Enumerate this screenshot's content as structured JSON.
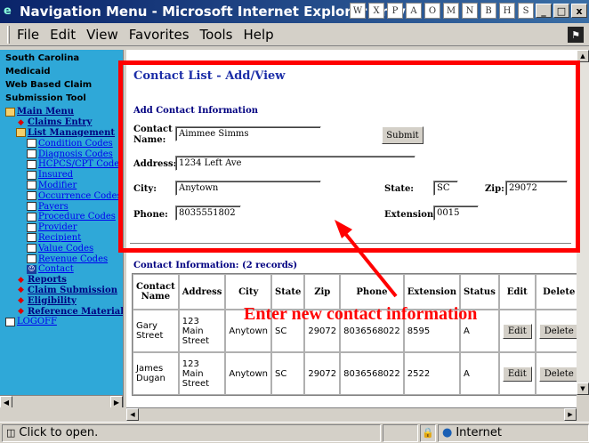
{
  "window": {
    "title": "Navigation Menu - Microsoft Internet Explorer prov",
    "minimize": "_",
    "maximize": "□",
    "close": "x"
  },
  "menu": [
    "File",
    "Edit",
    "View",
    "Favorites",
    "Tools",
    "Help"
  ],
  "sidebar": {
    "header": [
      "South Carolina Medicaid",
      "Web Based Claim",
      "Submission Tool"
    ],
    "items": [
      {
        "label": "Main Menu",
        "icon": "book-icon",
        "level": 0,
        "style": "bold"
      },
      {
        "label": "Claims Entry",
        "icon": "diamond-icon",
        "level": 1,
        "style": "bold"
      },
      {
        "label": "List Management",
        "icon": "book-icon",
        "level": 1,
        "style": "bold"
      },
      {
        "label": "Condition Codes",
        "icon": "page-icon",
        "level": 2,
        "style": "link"
      },
      {
        "label": "Diagnosis Codes",
        "icon": "page-icon",
        "level": 2,
        "style": "link"
      },
      {
        "label": "HCPCS/CPT Codes",
        "icon": "page-icon",
        "level": 2,
        "style": "link"
      },
      {
        "label": "Insured",
        "icon": "page-icon",
        "level": 2,
        "style": "link"
      },
      {
        "label": "Modifier",
        "icon": "page-icon",
        "level": 2,
        "style": "link"
      },
      {
        "label": "Occurrence Codes",
        "icon": "page-icon",
        "level": 2,
        "style": "link"
      },
      {
        "label": "Payers",
        "icon": "page-icon",
        "level": 2,
        "style": "link"
      },
      {
        "label": "Procedure Codes",
        "icon": "page-icon",
        "level": 2,
        "style": "link"
      },
      {
        "label": "Provider",
        "icon": "page-icon",
        "level": 2,
        "style": "link"
      },
      {
        "label": "Recipient",
        "icon": "page-icon",
        "level": 2,
        "style": "link"
      },
      {
        "label": "Value Codes",
        "icon": "page-icon",
        "level": 2,
        "style": "link"
      },
      {
        "label": "Revenue Codes",
        "icon": "page-icon",
        "level": 2,
        "style": "link"
      },
      {
        "label": "Contact",
        "icon": "contact-icon",
        "level": 2,
        "style": "link"
      },
      {
        "label": "Reports",
        "icon": "diamond-icon",
        "level": 1,
        "style": "bold"
      },
      {
        "label": "Claim Submission",
        "icon": "diamond-icon",
        "level": 1,
        "style": "bold"
      },
      {
        "label": "Eligibility",
        "icon": "diamond-icon",
        "level": 1,
        "style": "bold"
      },
      {
        "label": "Reference Materials",
        "icon": "diamond-icon",
        "level": 1,
        "style": "bold"
      },
      {
        "label": "LOGOFF",
        "icon": "page-icon",
        "level": 0,
        "style": "link"
      }
    ]
  },
  "main": {
    "page_title": "Contact List - Add/View",
    "section_title": "Add Contact Information",
    "form": {
      "contact_name_label": "Contact Name:",
      "contact_name_value": "Aimmee Simms",
      "submit_label": "Submit",
      "address_label": "Address:",
      "address_value": "1234 Left Ave",
      "city_label": "City:",
      "city_value": "Anytown",
      "state_label": "State:",
      "state_value": "SC",
      "zip_label": "Zip:",
      "zip_value": "29072",
      "phone_label": "Phone:",
      "phone_value": "8035551802",
      "extension_label": "Extension:",
      "extension_value": "0015"
    },
    "table_title": "Contact Information: (2 records)",
    "table": {
      "headers": [
        "Contact Name",
        "Address",
        "City",
        "State",
        "Zip",
        "Phone",
        "Extension",
        "Status",
        "Edit",
        "Delete"
      ],
      "rows": [
        {
          "name": "Gary Street",
          "address": "123 Main Street",
          "city": "Anytown",
          "state": "SC",
          "zip": "29072",
          "phone": "8036568022",
          "extension": "8595",
          "status": "A"
        },
        {
          "name": "James Dugan",
          "address": "123 Main Street",
          "city": "Anytown",
          "state": "SC",
          "zip": "29072",
          "phone": "8036568022",
          "extension": "2522",
          "status": "A"
        }
      ],
      "edit_label": "Edit",
      "delete_label": "Delete"
    }
  },
  "annotation": {
    "text": "Enter new contact information",
    "color": "#ff0000"
  },
  "status": {
    "text": "Click to open.",
    "zone": "Internet"
  }
}
